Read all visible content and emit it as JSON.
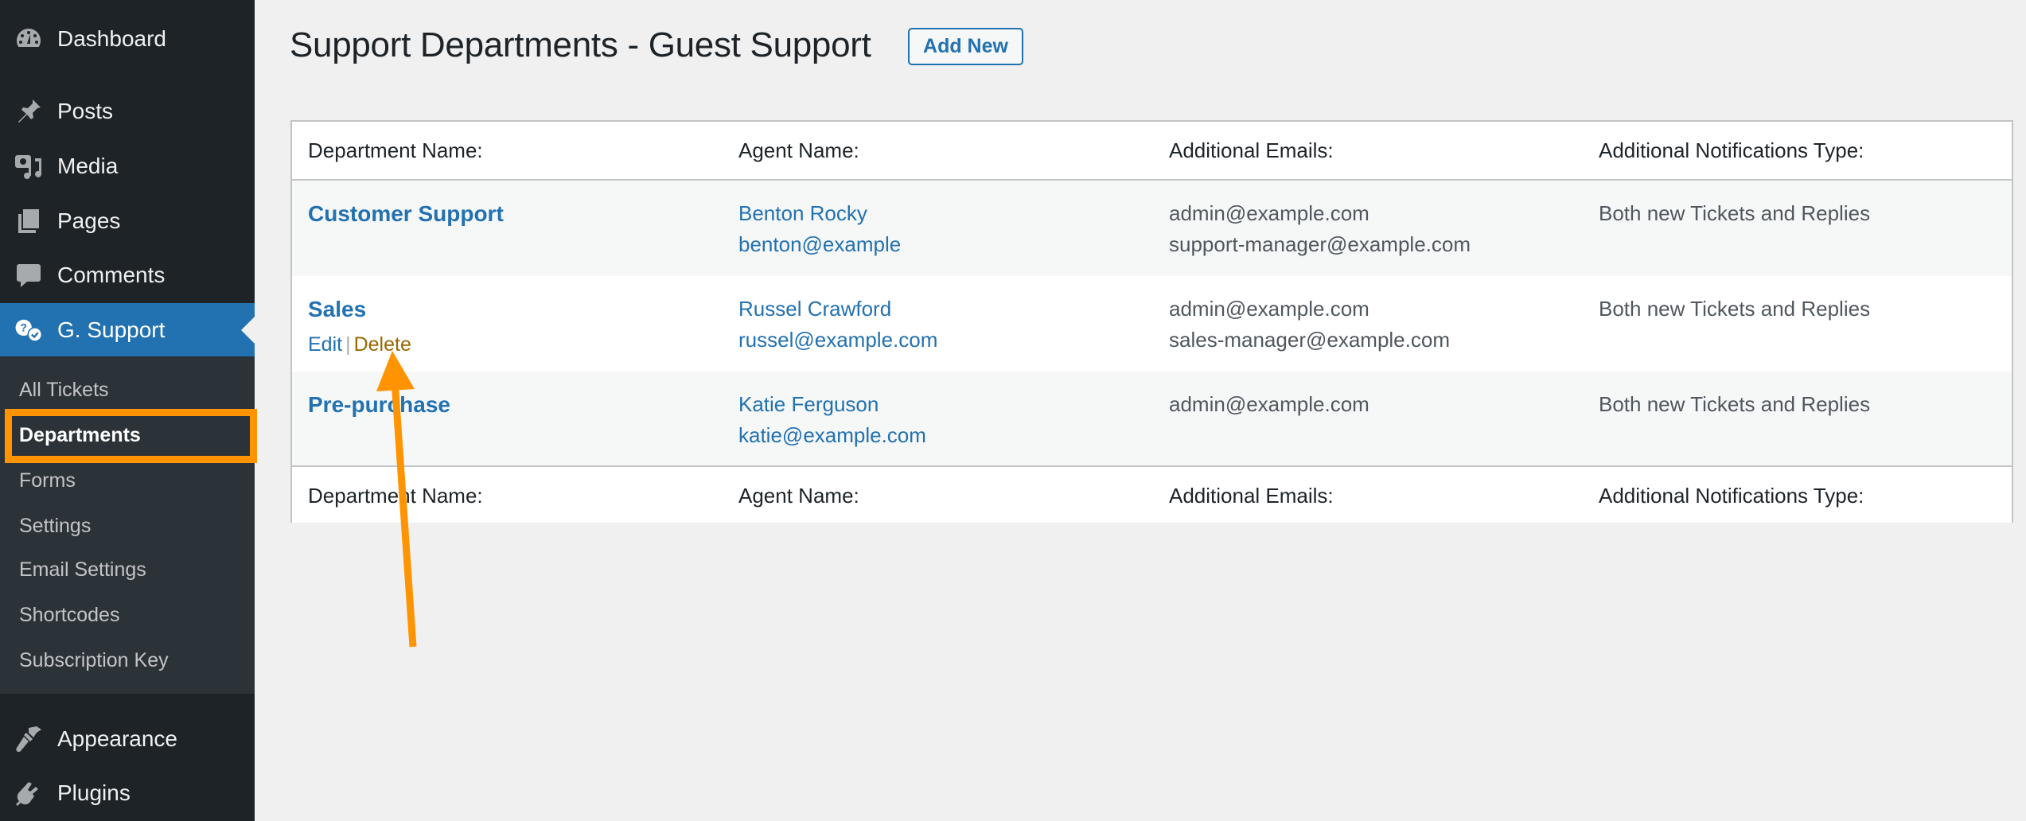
{
  "sidebar": {
    "top_items": [
      {
        "label": "Dashboard",
        "icon": "dashboard-icon"
      },
      {
        "label": "Posts",
        "icon": "pushpin-icon"
      },
      {
        "label": "Media",
        "icon": "media-icon"
      },
      {
        "label": "Pages",
        "icon": "pages-icon"
      },
      {
        "label": "Comments",
        "icon": "comments-icon"
      }
    ],
    "current_item": {
      "label": "G. Support",
      "icon": "support-icon"
    },
    "submenu": [
      {
        "label": "All Tickets"
      },
      {
        "label": "Departments",
        "current": true
      },
      {
        "label": "Forms"
      },
      {
        "label": "Settings"
      },
      {
        "label": "Email Settings"
      },
      {
        "label": "Shortcodes"
      },
      {
        "label": "Subscription Key"
      }
    ],
    "bottom_items": [
      {
        "label": "Appearance",
        "icon": "paintbrush-icon"
      },
      {
        "label": "Plugins",
        "icon": "plugin-icon"
      }
    ]
  },
  "header": {
    "title": "Support Departments - Guest Support",
    "add_new_label": "Add New"
  },
  "table": {
    "columns": [
      "Department Name:",
      "Agent Name:",
      "Additional Emails:",
      "Additional Notifications Type:"
    ],
    "rows": [
      {
        "department": "Customer Support",
        "agent_name": "Benton Rocky",
        "agent_email": "benton@example",
        "emails": [
          "admin@example.com",
          "support-manager@example.com"
        ],
        "notification_type": "Both new Tickets and Replies"
      },
      {
        "department": "Sales",
        "agent_name": "Russel Crawford",
        "agent_email": "russel@example.com",
        "emails": [
          "admin@example.com",
          "sales-manager@example.com"
        ],
        "notification_type": "Both new Tickets and Replies",
        "row_actions": {
          "edit": "Edit",
          "separator": "|",
          "delete": "Delete"
        }
      },
      {
        "department": "Pre-purchase",
        "agent_name": "Katie Ferguson",
        "agent_email": "katie@example.com",
        "emails": [
          "admin@example.com"
        ],
        "notification_type": "Both new Tickets and Replies"
      }
    ]
  },
  "annotations": {
    "highlight_color": "#ff9400",
    "highlight_target": "Departments",
    "arrow_target": "Delete"
  },
  "colors": {
    "sidebar_bg": "#1d2327",
    "submenu_bg": "#2c3338",
    "accent": "#2271b1",
    "delete_link": "#996800"
  }
}
